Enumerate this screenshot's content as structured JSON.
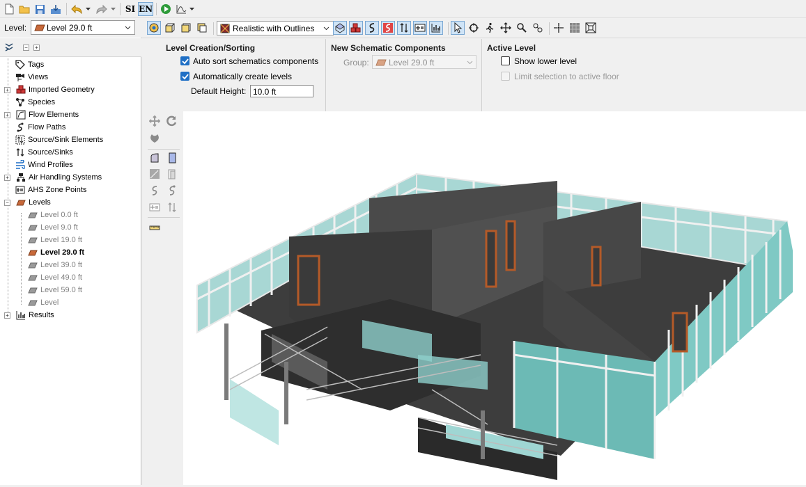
{
  "toolbar": {
    "si_label": "SI",
    "en_label": "EN"
  },
  "level_bar": {
    "label": "Level:",
    "selected": "Level 29.0 ft"
  },
  "tree": {
    "items": [
      {
        "label": "Tags"
      },
      {
        "label": "Views"
      },
      {
        "label": "Imported Geometry"
      },
      {
        "label": "Species"
      },
      {
        "label": "Flow Elements"
      },
      {
        "label": "Flow Paths"
      },
      {
        "label": "Source/Sink Elements"
      },
      {
        "label": "Source/Sinks"
      },
      {
        "label": "Wind Profiles"
      },
      {
        "label": "Air Handling Systems"
      },
      {
        "label": "AHS Zone Points"
      },
      {
        "label": "Levels"
      },
      {
        "label": "Results"
      }
    ],
    "levels": [
      {
        "label": "Level 0.0 ft"
      },
      {
        "label": "Level 9.0 ft"
      },
      {
        "label": "Level 19.0 ft"
      },
      {
        "label": "Level 29.0 ft",
        "active": true
      },
      {
        "label": "Level 39.0 ft"
      },
      {
        "label": "Level 49.0 ft"
      },
      {
        "label": "Level 59.0 ft"
      },
      {
        "label": "Level"
      }
    ]
  },
  "view_toolbar": {
    "render_mode": "Realistic with Outlines"
  },
  "level_creation": {
    "title": "Level Creation/Sorting",
    "auto_sort_label": "Auto sort schematics components",
    "auto_sort_checked": true,
    "auto_create_label": "Automatically create levels",
    "auto_create_checked": true,
    "default_height_label": "Default Height:",
    "default_height_value": "10.0 ft"
  },
  "new_schematic": {
    "title": "New Schematic Components",
    "group_label": "Group:",
    "group_value": "Level 29.0 ft"
  },
  "active_level": {
    "title": "Active Level",
    "show_lower_label": "Show lower level",
    "show_lower_checked": false,
    "limit_selection_label": "Limit selection to active floor",
    "limit_selection_checked": false
  },
  "colors": {
    "accent": "#1f6fc5",
    "level_icon": "#c8693a",
    "wall": "#3d3d3d",
    "glass": "#7fc9c4"
  }
}
